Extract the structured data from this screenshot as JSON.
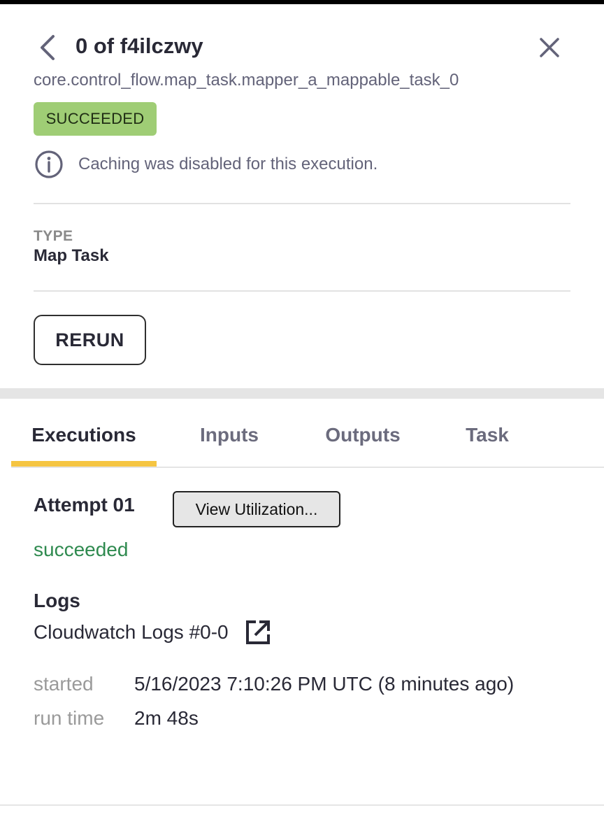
{
  "header": {
    "title": "0 of f4ilczwy",
    "subtitle": "core.control_flow.map_task.mapper_a_mappable_task_0",
    "status": "SUCCEEDED",
    "status_color": "#9fcd75",
    "cache_message": "Caching was disabled for this execution.",
    "icons": {
      "back": "chevron-left-icon",
      "close": "close-icon",
      "info": "info-icon"
    }
  },
  "details": {
    "type_label": "TYPE",
    "type_value": "Map Task",
    "rerun_label": "RERUN"
  },
  "tabs": [
    {
      "label": "Executions",
      "active": true
    },
    {
      "label": "Inputs",
      "active": false
    },
    {
      "label": "Outputs",
      "active": false
    },
    {
      "label": "Task",
      "active": false
    }
  ],
  "accent_color": "#f5c542",
  "execution": {
    "attempt_label": "Attempt 01",
    "view_utilization_label": "View Utilization...",
    "status": "succeeded",
    "status_color": "#2f8a4f",
    "logs_label": "Logs",
    "log_link": "Cloudwatch Logs #0-0",
    "log_link_icon": "external-link-icon",
    "started_label": "started",
    "started_value": "5/16/2023 7:10:26 PM UTC (8 minutes ago)",
    "run_time_label": "run time",
    "run_time_value": "2m 48s"
  }
}
